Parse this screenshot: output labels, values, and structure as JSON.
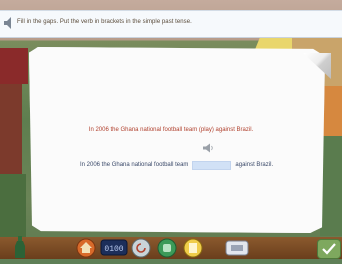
{
  "instructions": {
    "text": "Fill in the gaps. Put the verb in brackets in the simple past tense."
  },
  "exercise": {
    "prompt_sentence": "In 2006 the Ghana national football team (play) against Brazil.",
    "answer_prefix": "In 2006 the Ghana national football team",
    "answer_suffix": "against Brazil.",
    "answer_value": ""
  },
  "toolbar": {
    "counter_text": "0100"
  },
  "icons": {
    "instruction_audio": "speaker-icon",
    "sentence_audio": "speaker-icon",
    "ok": "check-icon",
    "drink": "bottle-icon"
  },
  "colors": {
    "prompt_text": "#b0412e",
    "answer_text": "#3b4a6a",
    "blank_fill": "#d1e1f6",
    "toolbar": "#6a3e1c"
  }
}
